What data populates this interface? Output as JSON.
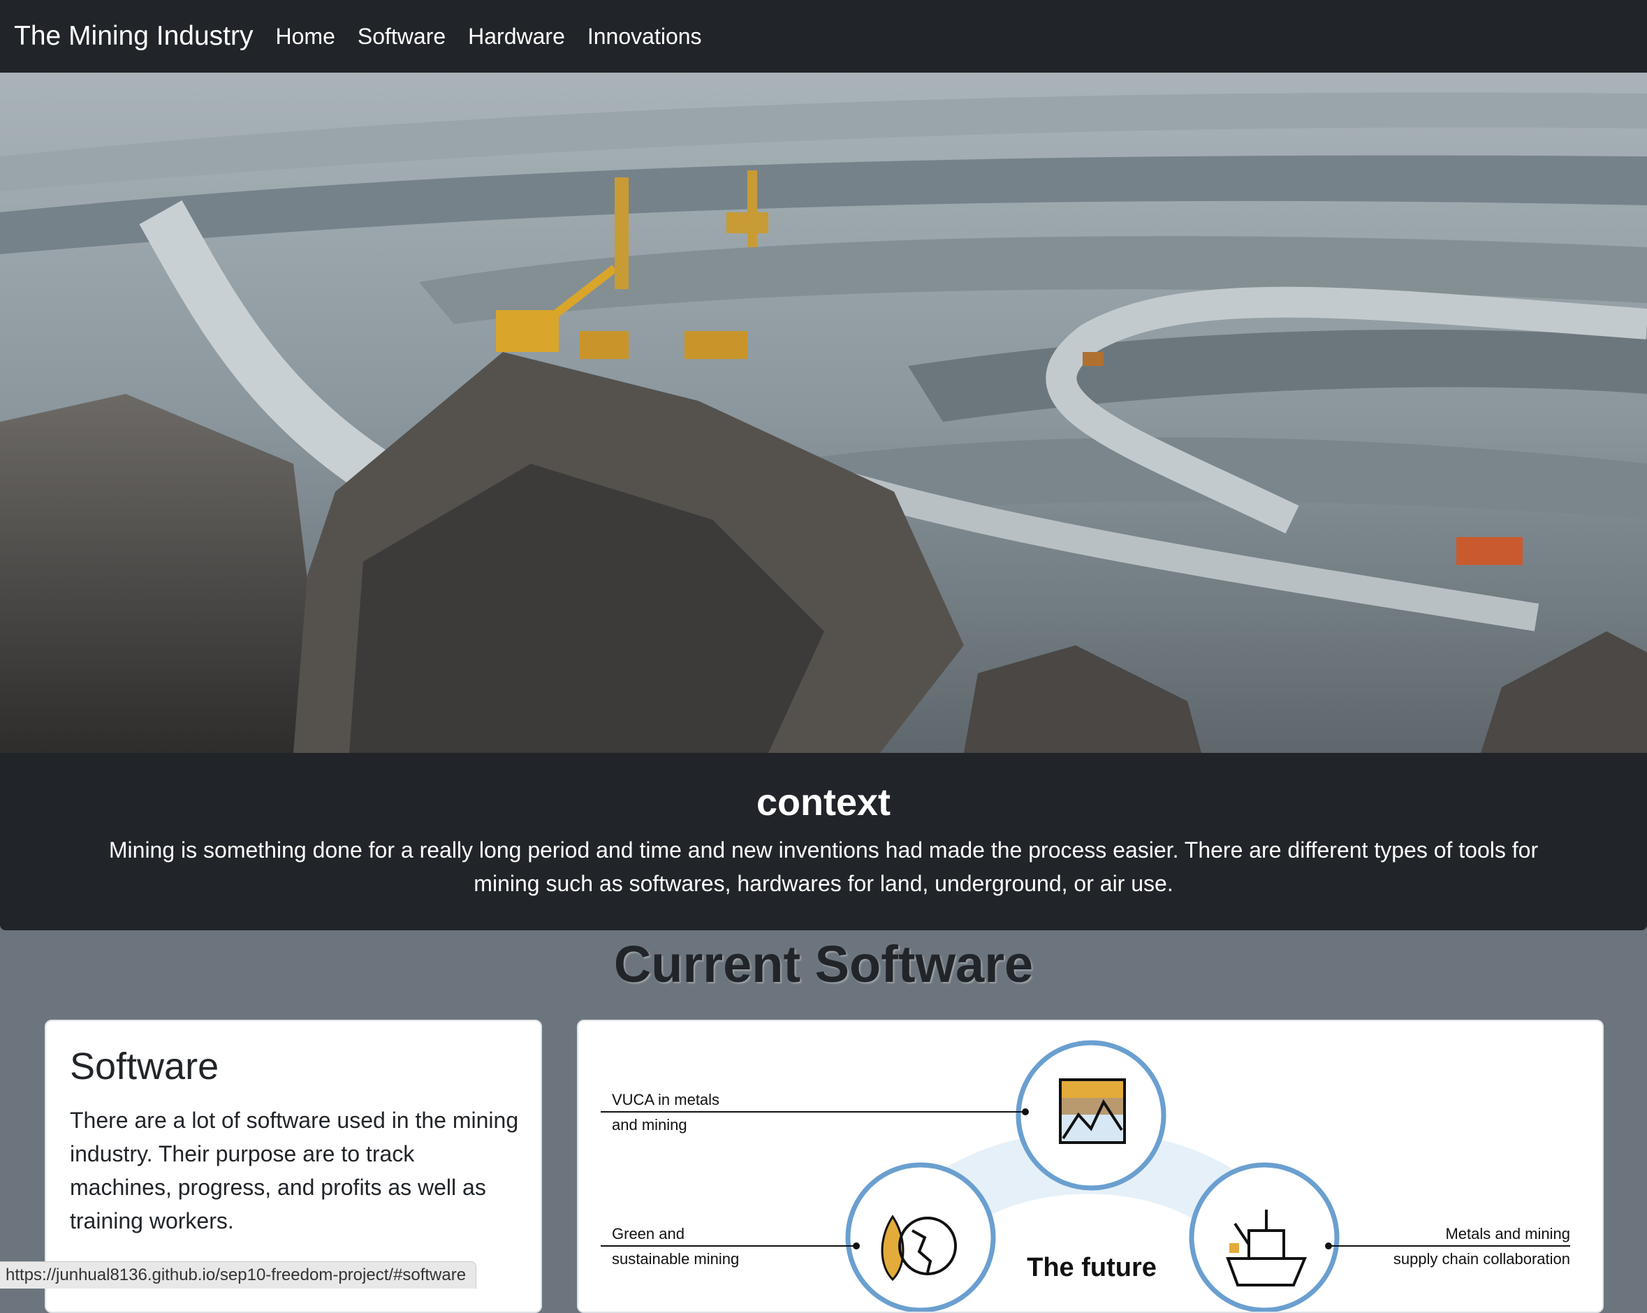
{
  "nav": {
    "brand": "The Mining Industry",
    "links": [
      "Home",
      "Software",
      "Hardware",
      "Innovations"
    ]
  },
  "context": {
    "title": "context",
    "body": "Mining is something done for a really long period and time and new inventions had made the process easier. There are different types of tools for mining such as softwares, hardwares for land, underground, or air use."
  },
  "software_section": {
    "title": "Current Software",
    "card": {
      "title": "Software",
      "body": "There are a lot of software used in the mining industry. Their purpose are to track machines, progress, and profits as well as training workers."
    },
    "diagram": {
      "label_top_left_1": "VUCA in metals",
      "label_top_left_2": "and mining",
      "label_bottom_left_1": "Green and",
      "label_bottom_left_2": "sustainable mining",
      "label_right_1": "Metals and mining",
      "label_right_2": "supply chain collaboration",
      "center_title": "The future",
      "ring_color": "#6a9fd0"
    }
  },
  "status_bar": {
    "url": "https://junhual8136.github.io/sep10-freedom-project/#software"
  },
  "colors": {
    "navbar_bg": "#212529",
    "page_bg": "#6c757d",
    "card_bg": "#ffffff"
  }
}
